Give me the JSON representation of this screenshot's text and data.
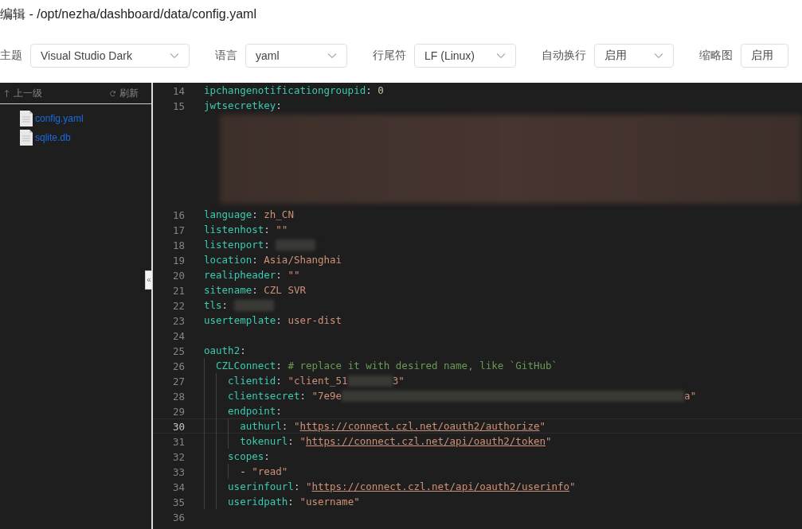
{
  "window": {
    "title": "编辑 - /opt/nezha/dashboard/data/config.yaml"
  },
  "toolbar": [
    {
      "label": "主题",
      "value": "Visual Studio Dark",
      "kind": "wide"
    },
    {
      "label": "语言",
      "value": "yaml",
      "kind": "medium"
    },
    {
      "label": "行尾符",
      "value": "LF (Linux)",
      "kind": "medium"
    },
    {
      "label": "自动换行",
      "value": "启用",
      "kind": "narrow"
    },
    {
      "label": "缩略图",
      "value": "启用",
      "kind": "cut"
    }
  ],
  "sidebar": {
    "up": "上一级",
    "refresh": "刷新",
    "files": [
      {
        "name": "config.yaml"
      },
      {
        "name": "sqlite.db"
      }
    ]
  },
  "editor": {
    "lines": [
      {
        "num": "14",
        "active": false,
        "tokens": [
          {
            "kind": "key",
            "text": "ipchangenotificationgroupid"
          },
          {
            "kind": "punct",
            "text": ": "
          },
          {
            "kind": "number",
            "text": "0"
          }
        ]
      },
      {
        "num": "15",
        "active": false,
        "tokens": [
          {
            "kind": "key",
            "text": "jwtsecretkey"
          },
          {
            "kind": "punct",
            "text": ":"
          },
          {
            "kind": "redacted-block"
          }
        ]
      },
      {
        "num": "16",
        "active": false,
        "tokens": [
          {
            "kind": "key",
            "text": "language"
          },
          {
            "kind": "punct",
            "text": ": "
          },
          {
            "kind": "string",
            "text": "zh_CN"
          }
        ]
      },
      {
        "num": "17",
        "active": false,
        "tokens": [
          {
            "kind": "key",
            "text": "listenhost"
          },
          {
            "kind": "punct",
            "text": ": "
          },
          {
            "kind": "string",
            "text": "\"\""
          }
        ]
      },
      {
        "num": "18",
        "active": false,
        "tokens": [
          {
            "kind": "key",
            "text": "listenport"
          },
          {
            "kind": "punct",
            "text": ": "
          },
          {
            "kind": "redacted-short"
          }
        ]
      },
      {
        "num": "19",
        "active": false,
        "tokens": [
          {
            "kind": "key",
            "text": "location"
          },
          {
            "kind": "punct",
            "text": ": "
          },
          {
            "kind": "string",
            "text": "Asia/Shanghai"
          }
        ]
      },
      {
        "num": "20",
        "active": false,
        "tokens": [
          {
            "kind": "key",
            "text": "realipheader"
          },
          {
            "kind": "punct",
            "text": ": "
          },
          {
            "kind": "string",
            "text": "\"\""
          }
        ]
      },
      {
        "num": "21",
        "active": false,
        "tokens": [
          {
            "kind": "key",
            "text": "sitename"
          },
          {
            "kind": "punct",
            "text": ": "
          },
          {
            "kind": "string",
            "text": "CZL SVR"
          }
        ]
      },
      {
        "num": "22",
        "active": false,
        "tokens": [
          {
            "kind": "key",
            "text": "tls"
          },
          {
            "kind": "punct",
            "text": ": "
          },
          {
            "kind": "redacted-short"
          }
        ]
      },
      {
        "num": "23",
        "active": false,
        "tokens": [
          {
            "kind": "key",
            "text": "usertemplate"
          },
          {
            "kind": "punct",
            "text": ": "
          },
          {
            "kind": "string",
            "text": "user-dist"
          }
        ]
      },
      {
        "num": "24",
        "active": false
      },
      {
        "num": "25",
        "active": false,
        "tokens": [
          {
            "kind": "key",
            "text": "oauth2"
          },
          {
            "kind": "punct",
            "text": ":"
          }
        ],
        "children": [
          {
            "num": "26",
            "active": false,
            "tokens": [
              {
                "kind": "key",
                "text": "CZLConnect"
              },
              {
                "kind": "punct",
                "text": ": "
              },
              {
                "kind": "comment",
                "text": "# replace it with desired name, like `GitHub`"
              }
            ],
            "children": [
              {
                "num": "27",
                "active": false,
                "tokens": [
                  {
                    "kind": "key",
                    "text": "clientid"
                  },
                  {
                    "kind": "punct",
                    "text": ": "
                  },
                  {
                    "kind": "string",
                    "text": "\"client_51"
                  },
                  {
                    "kind": "redacted-medium"
                  },
                  {
                    "kind": "string",
                    "text": "3\""
                  }
                ]
              },
              {
                "num": "28",
                "active": false,
                "tokens": [
                  {
                    "kind": "key",
                    "text": "clientsecret"
                  },
                  {
                    "kind": "punct",
                    "text": ": "
                  },
                  {
                    "kind": "string",
                    "text": "\"7e9e"
                  },
                  {
                    "kind": "redacted-long"
                  },
                  {
                    "kind": "string",
                    "text": "a\""
                  }
                ]
              },
              {
                "num": "29",
                "active": false,
                "tokens": [
                  {
                    "kind": "key",
                    "text": "endpoint"
                  },
                  {
                    "kind": "punct",
                    "text": ":"
                  }
                ],
                "children": [
                  {
                    "num": "30",
                    "active": true,
                    "tokens": [
                      {
                        "kind": "key",
                        "text": "authurl"
                      },
                      {
                        "kind": "punct",
                        "text": ": "
                      },
                      {
                        "kind": "string",
                        "text": "\""
                      },
                      {
                        "kind": "link",
                        "text": "https://connect.czl.net/oauth2/authorize"
                      },
                      {
                        "kind": "string",
                        "text": "\""
                      }
                    ]
                  },
                  {
                    "num": "31",
                    "active": false,
                    "tokens": [
                      {
                        "kind": "key",
                        "text": "tokenurl"
                      },
                      {
                        "kind": "punct",
                        "text": ": "
                      },
                      {
                        "kind": "string",
                        "text": "\""
                      },
                      {
                        "kind": "link",
                        "text": "https://connect.czl.net/api/oauth2/token"
                      },
                      {
                        "kind": "string",
                        "text": "\""
                      }
                    ]
                  }
                ]
              },
              {
                "num": "32",
                "active": false,
                "tokens": [
                  {
                    "kind": "key",
                    "text": "scopes"
                  },
                  {
                    "kind": "punct",
                    "text": ":"
                  }
                ],
                "children": [
                  {
                    "num": "33",
                    "active": false,
                    "tokens": [
                      {
                        "kind": "punct",
                        "text": "- "
                      },
                      {
                        "kind": "string",
                        "text": "\"read\""
                      }
                    ]
                  }
                ]
              },
              {
                "num": "34",
                "active": false,
                "tokens": [
                  {
                    "kind": "key",
                    "text": "userinfourl"
                  },
                  {
                    "kind": "punct",
                    "text": ": "
                  },
                  {
                    "kind": "string",
                    "text": "\""
                  },
                  {
                    "kind": "link",
                    "text": "https://connect.czl.net/api/oauth2/userinfo"
                  },
                  {
                    "kind": "string",
                    "text": "\""
                  }
                ]
              },
              {
                "num": "35",
                "active": false,
                "tokens": [
                  {
                    "kind": "key",
                    "text": "useridpath"
                  },
                  {
                    "kind": "punct",
                    "text": ": "
                  },
                  {
                    "kind": "string",
                    "text": "\"username\""
                  }
                ]
              }
            ]
          }
        ]
      },
      {
        "num": "36",
        "active": false
      }
    ],
    "collapse_handle": "«"
  }
}
